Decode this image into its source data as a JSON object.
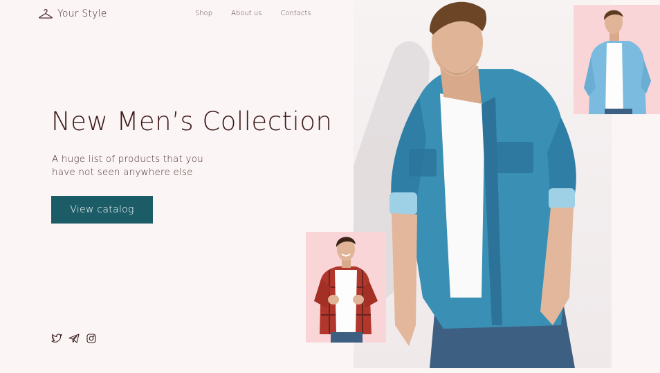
{
  "brand": {
    "name": "Your Style",
    "icon": "hanger-icon"
  },
  "nav": {
    "items": [
      "Shop",
      "About us",
      "Contacts"
    ]
  },
  "hero": {
    "title": "New Men’s Collection",
    "subtitle": "A huge list of products that you have not seen anywhere else",
    "cta_label": "View catalog"
  },
  "socials": [
    "twitter-icon",
    "telegram-icon",
    "instagram-icon"
  ],
  "colors": {
    "accent": "#1c5c67",
    "background": "#fbf5f5",
    "photo_bg": "#fad5d8",
    "text": "#3b1717"
  }
}
